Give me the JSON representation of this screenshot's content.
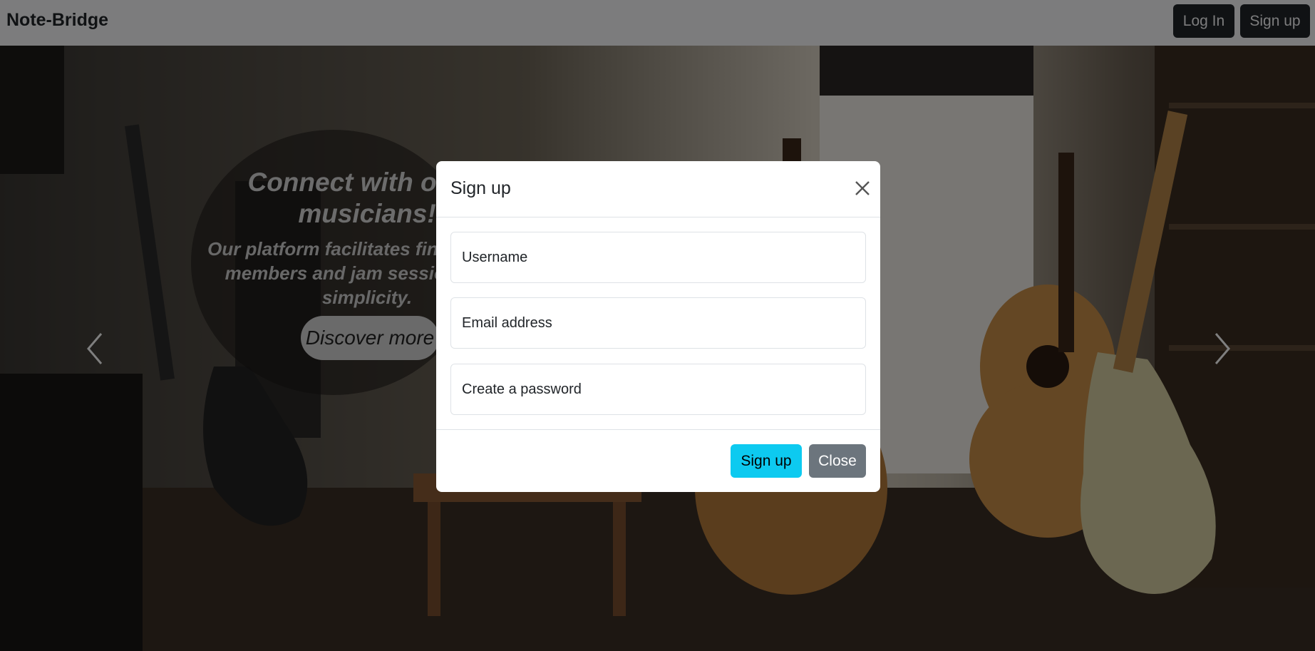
{
  "navbar": {
    "brand": "Note-Bridge",
    "login_label": "Log In",
    "signup_label": "Sign up"
  },
  "hero": {
    "caption_title": "Connect with other musicians!",
    "caption_text": "Our platform facilitates finding band members and jam sessions with simplicity.",
    "discover_label": "Discover more",
    "prev_icon": "chevron-left-icon",
    "next_icon": "chevron-right-icon"
  },
  "modal": {
    "title": "Sign up",
    "close_icon": "close-icon",
    "username_placeholder": "Username",
    "email_placeholder": "Email address",
    "password_placeholder": "Create a password",
    "signup_label": "Sign up",
    "close_label": "Close"
  },
  "colors": {
    "navbar_bg": "#f8f9fa",
    "nav_button_bg": "#212529",
    "signup_button_bg": "#0dcaf0",
    "close_button_bg": "#6c757d",
    "backdrop": "rgba(0,0,0,0.5)"
  }
}
